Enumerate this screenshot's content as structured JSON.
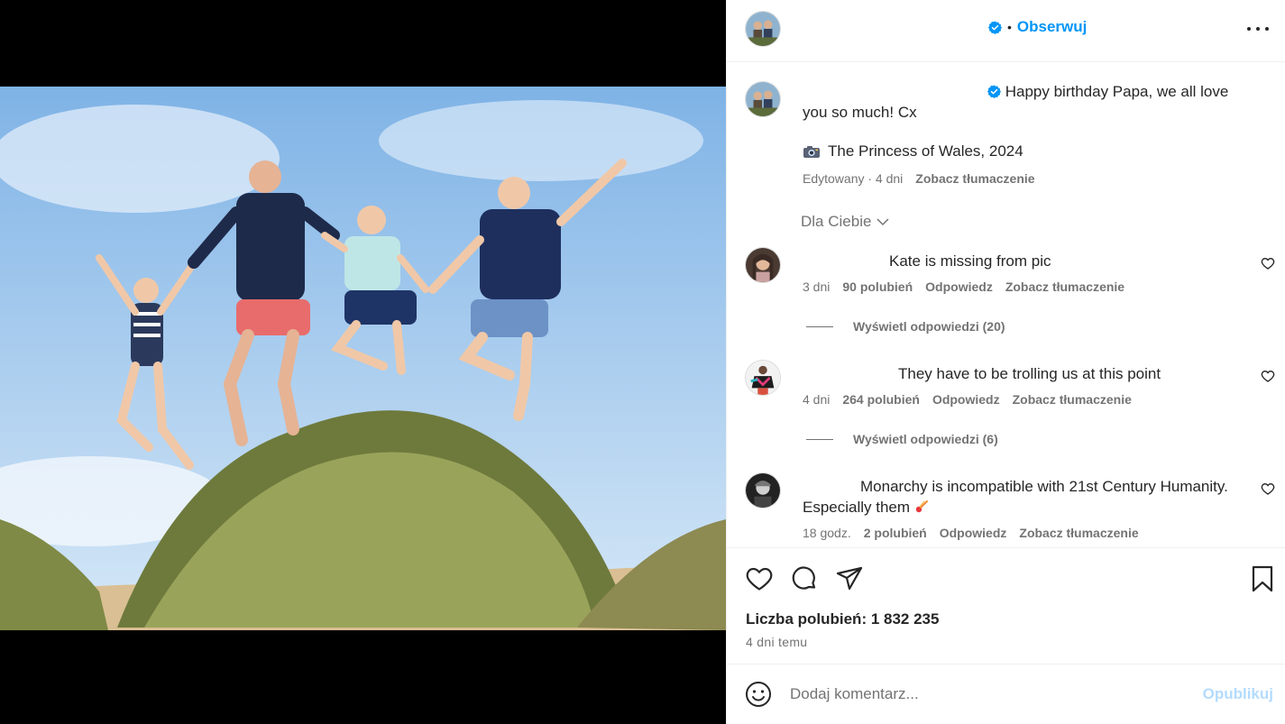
{
  "post": {
    "header": {
      "dot": "•",
      "follow_label": "Obserwuj",
      "more_icon": "more-horizontal-icon"
    },
    "caption": {
      "text": "Happy birthday Papa, we all love you so much! Cx",
      "credit": "The Princess of Wales, 2024",
      "edited": "Edytowany · 4 dni",
      "translate": "Zobacz tłumaczenie"
    },
    "for_you_label": "Dla Ciebie",
    "comments": [
      {
        "text": "Kate is missing from pic",
        "time": "3 dni",
        "likes": "90 polubień",
        "reply": "Odpowiedz",
        "translate": "Zobacz tłumaczenie",
        "view_replies": "Wyświetl odpowiedzi (20)"
      },
      {
        "text": "They have to be trolling us at this point",
        "time": "4 dni",
        "likes": "264 polubień",
        "reply": "Odpowiedz",
        "translate": "Zobacz tłumaczenie",
        "view_replies": "Wyświetl odpowiedzi (6)"
      },
      {
        "text": "Monarchy is incompatible with 21st Century Humanity. Especially them",
        "time": "18 godz.",
        "likes": "2 polubień",
        "reply": "Odpowiedz",
        "translate": "Zobacz tłumaczenie"
      }
    ],
    "likes_count": "Liczba polubień: 1 832 235",
    "posted_ago": "4 dni temu",
    "add_comment": {
      "placeholder": "Dodaj komentarz...",
      "publish": "Opublikuj"
    }
  },
  "colors": {
    "accent": "#0095f6",
    "secondary_text": "#737373",
    "publish_disabled": "#b3dbff"
  }
}
